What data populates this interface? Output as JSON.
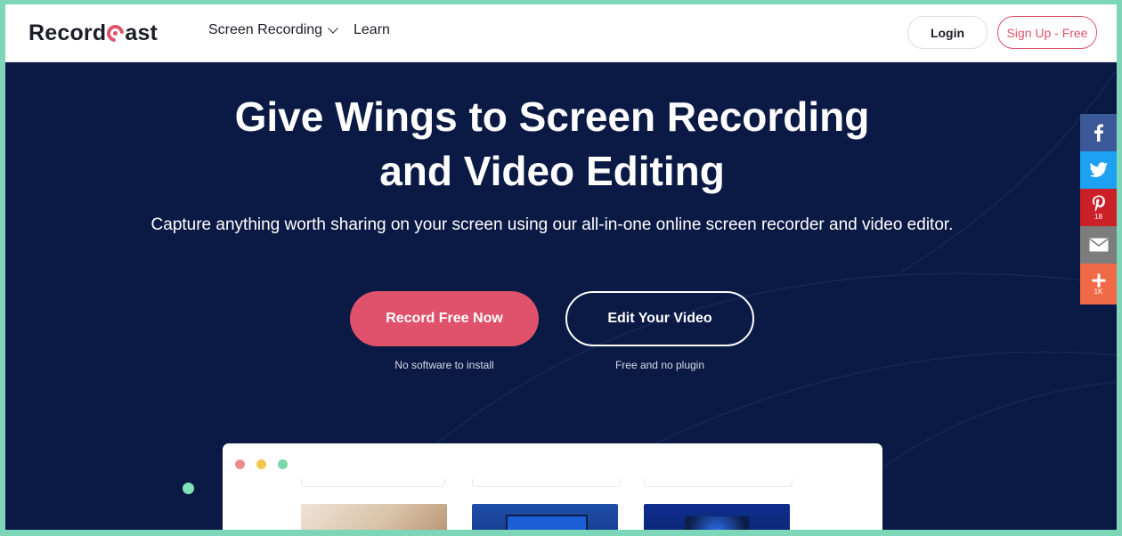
{
  "header": {
    "logo": {
      "prefix": "Record",
      "suffix": "ast"
    },
    "nav": [
      {
        "label": "Screen Recording",
        "has_dropdown": true
      },
      {
        "label": "Learn",
        "has_dropdown": false
      }
    ],
    "login_label": "Login",
    "signup_label": "Sign Up - Free"
  },
  "hero": {
    "title_line1": "Give Wings to Screen Recording",
    "title_line2": "and Video Editing",
    "subtitle": "Capture anything worth sharing on your screen using our all-in-one online screen recorder and video editor.",
    "primary_button": "Record Free Now",
    "primary_note": "No software to install",
    "secondary_button": "Edit Your Video",
    "secondary_note": "Free and no plugin"
  },
  "social": [
    {
      "icon": "facebook-icon",
      "count": "",
      "color": "#3b5998"
    },
    {
      "icon": "twitter-icon",
      "count": "",
      "color": "#1da1f2"
    },
    {
      "icon": "pinterest-icon",
      "count": "18",
      "color": "#cb2027"
    },
    {
      "icon": "email-icon",
      "count": "",
      "color": "#7d7d7d"
    },
    {
      "icon": "share-more-icon",
      "count": "1K",
      "color": "#f16a48"
    }
  ],
  "colors": {
    "accent": "#e0526b",
    "hero_background": "#0b1a45",
    "frame": "#7ed6b9"
  }
}
